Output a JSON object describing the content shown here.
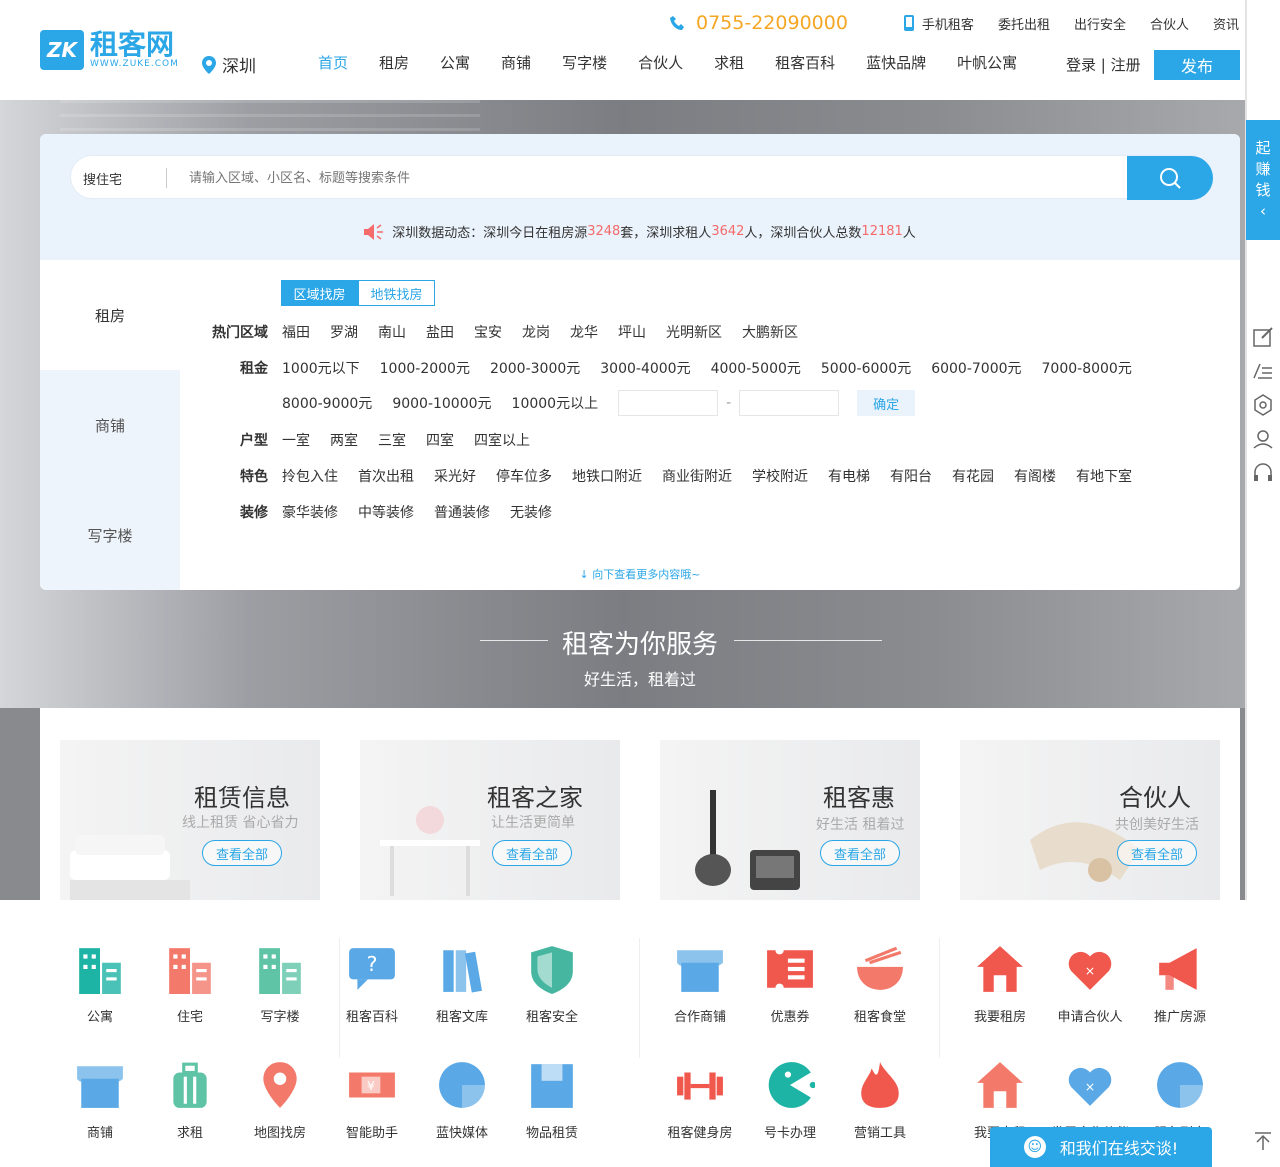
{
  "header": {
    "logo_mark": "ZK",
    "logo_cn": "租客网",
    "logo_en": "WWW.ZUKE.COM",
    "city": "深圳",
    "phone": "0755-22090000",
    "top_links": [
      "手机租客",
      "委托出租",
      "出行安全",
      "合伙人",
      "资讯"
    ],
    "nav": [
      "首页",
      "租房",
      "公寓",
      "商铺",
      "写字楼",
      "合伙人",
      "求租",
      "租客百科",
      "蓝快品牌",
      "叶帆公寓"
    ],
    "login": "登录 | 注册",
    "publish": "发布"
  },
  "search": {
    "label": "搜住宅",
    "placeholder": "请输入区域、小区名、标题等搜索条件",
    "dynamic_prefix": "深圳数据动态：深圳今日在租房源",
    "houses": "3248",
    "mid1": "套，深圳求租人",
    "seekers": "3642",
    "mid2": "人，深圳合伙人总数",
    "partners": "12181",
    "suffix": "人"
  },
  "tabs": [
    "租房",
    "商铺",
    "写字楼"
  ],
  "filters": {
    "toggle": [
      "区域找房",
      "地铁找房"
    ],
    "area_label": "热门区域",
    "areas": [
      "福田",
      "罗湖",
      "南山",
      "盐田",
      "宝安",
      "龙岗",
      "龙华",
      "坪山",
      "光明新区",
      "大鹏新区"
    ],
    "rent_label": "租金",
    "rents_row1": [
      "1000元以下",
      "1000-2000元",
      "2000-3000元",
      "3000-4000元",
      "4000-5000元",
      "5000-6000元",
      "6000-7000元",
      "7000-8000元"
    ],
    "rents_row2": [
      "8000-9000元",
      "9000-10000元",
      "10000元以上"
    ],
    "dash": "-",
    "confirm": "确定",
    "type_label": "户型",
    "types": [
      "一室",
      "两室",
      "三室",
      "四室",
      "四室以上"
    ],
    "feature_label": "特色",
    "features": [
      "拎包入住",
      "首次出租",
      "采光好",
      "停车位多",
      "地铁口附近",
      "商业街附近",
      "学校附近",
      "有电梯",
      "有阳台",
      "有花园",
      "有阁楼",
      "有地下室"
    ],
    "decor_label": "装修",
    "decors": [
      "豪华装修",
      "中等装修",
      "普通装修",
      "无装修"
    ],
    "more": "向下查看更多内容哦~"
  },
  "serve": {
    "title": "租客为你服务",
    "subtitle": "好生活，租着过"
  },
  "cards": [
    {
      "title": "租赁信息",
      "sub": "线上租赁 省心省力",
      "btn": "查看全部"
    },
    {
      "title": "租客之家",
      "sub": "让生活更简单",
      "btn": "查看全部"
    },
    {
      "title": "租客惠",
      "sub": "好生活 租着过",
      "btn": "查看全部"
    },
    {
      "title": "合伙人",
      "sub": "共创美好生活",
      "btn": "查看全部"
    }
  ],
  "icons": [
    {
      "label": "公寓",
      "icon": "apartment-icon",
      "color": "#1db3a5"
    },
    {
      "label": "住宅",
      "icon": "residence-icon",
      "color": "#f37a6b"
    },
    {
      "label": "写字楼",
      "icon": "office-icon",
      "color": "#5fc4a6"
    },
    {
      "label": "租客百科",
      "icon": "wiki-icon",
      "color": "#5aa9e6"
    },
    {
      "label": "租客文库",
      "icon": "library-icon",
      "color": "#5aa9e6"
    },
    {
      "label": "租客安全",
      "icon": "shield-icon",
      "color": "#46b6a0"
    },
    {
      "label": "合作商铺",
      "icon": "shop-icon",
      "color": "#5aa9e6"
    },
    {
      "label": "优惠券",
      "icon": "coupon-icon",
      "color": "#f0574d"
    },
    {
      "label": "租客食堂",
      "icon": "canteen-icon",
      "color": "#f37a6b"
    },
    {
      "label": "我要租房",
      "icon": "house-icon",
      "color": "#f0574d"
    },
    {
      "label": "申请合伙人",
      "icon": "heart-icon",
      "color": "#f0574d"
    },
    {
      "label": "推广房源",
      "icon": "megaphone-icon",
      "color": "#f0574d"
    },
    {
      "label": "商铺",
      "icon": "store-icon",
      "color": "#5aa9e6"
    },
    {
      "label": "求租",
      "icon": "luggage-icon",
      "color": "#5fc4a6"
    },
    {
      "label": "地图找房",
      "icon": "map-pin-icon",
      "color": "#f37a6b"
    },
    {
      "label": "智能助手",
      "icon": "ticket-icon",
      "color": "#f37a6b"
    },
    {
      "label": "蓝快媒体",
      "icon": "media-icon",
      "color": "#5aa9e6"
    },
    {
      "label": "物品租赁",
      "icon": "box-icon",
      "color": "#5aa9e6"
    },
    {
      "label": "租客健身房",
      "icon": "dumbbell-icon",
      "color": "#f0574d"
    },
    {
      "label": "号卡办理",
      "icon": "pacman-icon",
      "color": "#1db3a5"
    },
    {
      "label": "营销工具",
      "icon": "flame-icon",
      "color": "#f0574d"
    },
    {
      "label": "我要出租",
      "icon": "house-out-icon",
      "color": "#f37a6b"
    },
    {
      "label": "发展合作伙伴",
      "icon": "partner-icon",
      "color": "#5aa9e6"
    },
    {
      "label": "服务到家",
      "icon": "home-service-icon",
      "color": "#5aa9e6"
    }
  ],
  "side": {
    "earn": [
      "起",
      "赚",
      "钱"
    ],
    "chevron": "‹"
  },
  "chat": {
    "label": "和我们在线交谈!"
  }
}
